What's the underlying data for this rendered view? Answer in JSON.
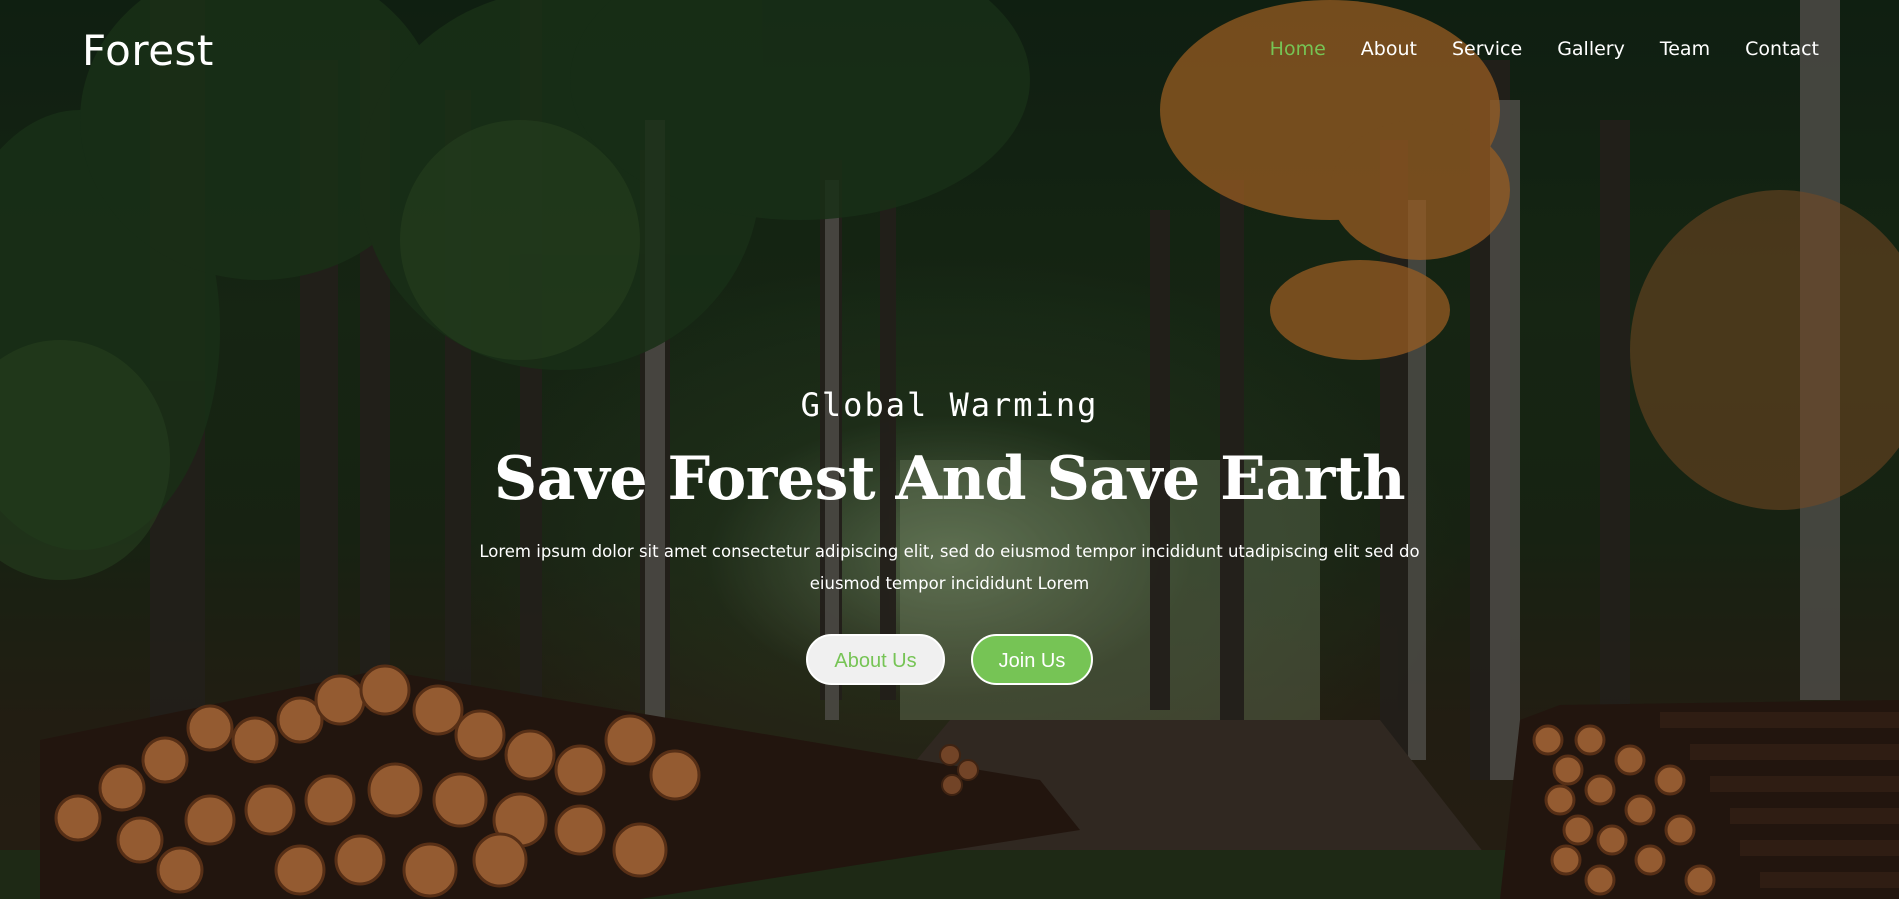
{
  "brand": {
    "logo_text": "Forest"
  },
  "nav": {
    "items": [
      {
        "label": "Home",
        "active": true
      },
      {
        "label": "About",
        "active": false
      },
      {
        "label": "Service",
        "active": false
      },
      {
        "label": "Gallery",
        "active": false
      },
      {
        "label": "Team",
        "active": false
      },
      {
        "label": "Contact",
        "active": false
      }
    ]
  },
  "hero": {
    "kicker": "Global Warming",
    "headline": "Save Forest And Save Earth",
    "description": "Lorem ipsum dolor sit amet consectetur adipiscing elit, sed do eiusmod tempor incididunt utadipiscing elit sed do eiusmod tempor incididunt Lorem",
    "primary_button": "About Us",
    "secondary_button": "Join Us"
  },
  "colors": {
    "accent": "#76c455",
    "text": "#ffffff",
    "button_light": "#f0f0f0"
  }
}
